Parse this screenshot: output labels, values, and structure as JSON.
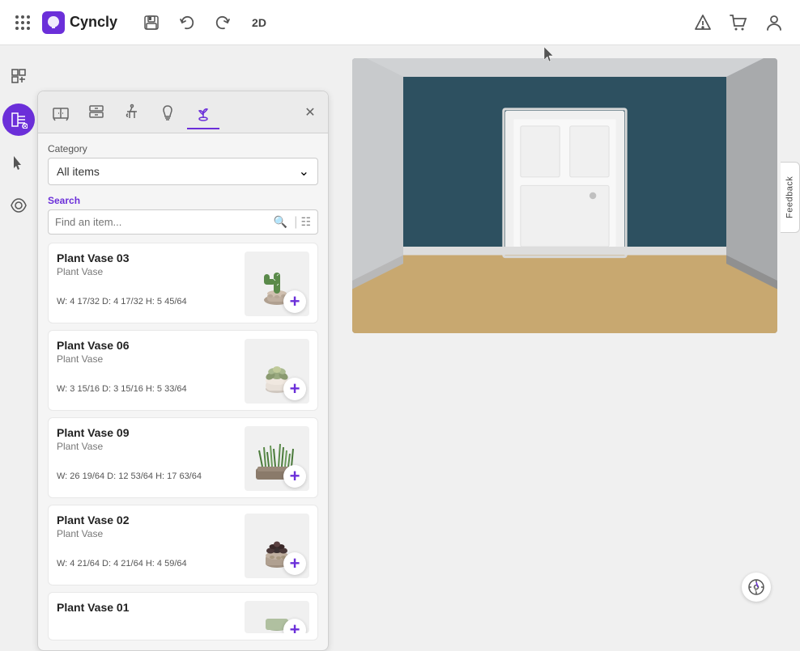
{
  "app": {
    "name": "Cyncly",
    "logo_letter": "C"
  },
  "toolbar": {
    "save_label": "💾",
    "undo_label": "↩",
    "redo_label": "↪",
    "view_2d_label": "2D",
    "warning_icon": "⚠",
    "cart_icon": "🛒",
    "user_icon": "👤"
  },
  "panel": {
    "close_label": "✕",
    "tabs": [
      {
        "id": "tab1",
        "icon": "cabinet",
        "active": false
      },
      {
        "id": "tab2",
        "icon": "storage",
        "active": false
      },
      {
        "id": "tab3",
        "icon": "faucet",
        "active": false
      },
      {
        "id": "tab4",
        "icon": "light",
        "active": false
      },
      {
        "id": "tab5",
        "icon": "plant",
        "active": true
      }
    ],
    "category": {
      "label": "Category",
      "value": "All items"
    },
    "search": {
      "label": "Search",
      "placeholder": "Find an item..."
    }
  },
  "items": [
    {
      "id": "plant-vase-03",
      "name": "Plant Vase 03",
      "subtype": "Plant Vase",
      "dims": "W: 4 17/32   D: 4 17/32   H: 5 45/64",
      "color1": "#5a7a4a",
      "color2": "#8a9a7a"
    },
    {
      "id": "plant-vase-06",
      "name": "Plant Vase 06",
      "subtype": "Plant Vase",
      "dims": "W: 3 15/16   D: 3 15/16   H: 5 33/64",
      "color1": "#b0a080",
      "color2": "#d0c0a0"
    },
    {
      "id": "plant-vase-09",
      "name": "Plant Vase 09",
      "subtype": "Plant Vase",
      "dims": "W: 26 19/64  D: 12 53/64  H: 17 63/64",
      "color1": "#4a6a3a",
      "color2": "#6a8a5a"
    },
    {
      "id": "plant-vase-02",
      "name": "Plant Vase 02",
      "subtype": "Plant Vase",
      "dims": "W: 4 21/64   D: 4 21/64   H: 4 59/64",
      "color1": "#6a5a4a",
      "color2": "#4a4040"
    },
    {
      "id": "plant-vase-01",
      "name": "Plant Vase 01",
      "subtype": "Plant Vase",
      "dims": "",
      "color1": "#5a7a5a",
      "color2": "#8aaa7a"
    }
  ],
  "feedback": {
    "label": "Feedback"
  },
  "compass": {
    "icon": "⊕"
  }
}
